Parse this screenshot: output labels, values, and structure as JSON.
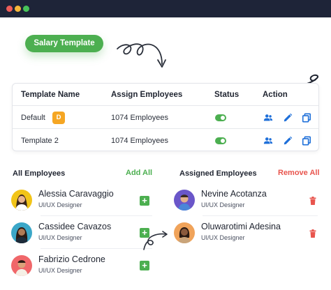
{
  "window": {
    "controls": [
      "close",
      "minimize",
      "maximize"
    ]
  },
  "salary_template_button": "Salary Template",
  "table": {
    "headers": {
      "name": "Template Name",
      "assign": "Assign Employees",
      "status": "Status",
      "action": "Action"
    },
    "rows": [
      {
        "name": "Default",
        "badge": "D",
        "employees": "1074 Employees",
        "status": "on"
      },
      {
        "name": "Template 2",
        "employees": "1074 Employees",
        "status": "on"
      }
    ],
    "actions": [
      "users-icon",
      "pencil-icon",
      "copy-icon"
    ]
  },
  "all_employees": {
    "title": "All Employees",
    "action": "Add All",
    "items": [
      {
        "name": "Alessia Caravaggio",
        "role": "UI/UX Designer"
      },
      {
        "name": "Cassidee Cavazos",
        "role": "UI/UX Designer"
      },
      {
        "name": "Fabrizio Cedrone",
        "role": "UI/UX Designer"
      }
    ]
  },
  "assigned_employees": {
    "title": "Assigned Employees",
    "action": "Remove All",
    "items": [
      {
        "name": "Nevine Acotanza",
        "role": "UI/UX Designer"
      },
      {
        "name": "Oluwarotimi Adesina",
        "role": "UI/UX Designer"
      }
    ]
  },
  "colors": {
    "primary_green": "#4caf50",
    "accent_blue": "#1e6fd9",
    "danger_red": "#e8554e",
    "badge_orange": "#f5a623",
    "titlebar": "#1e2438"
  }
}
